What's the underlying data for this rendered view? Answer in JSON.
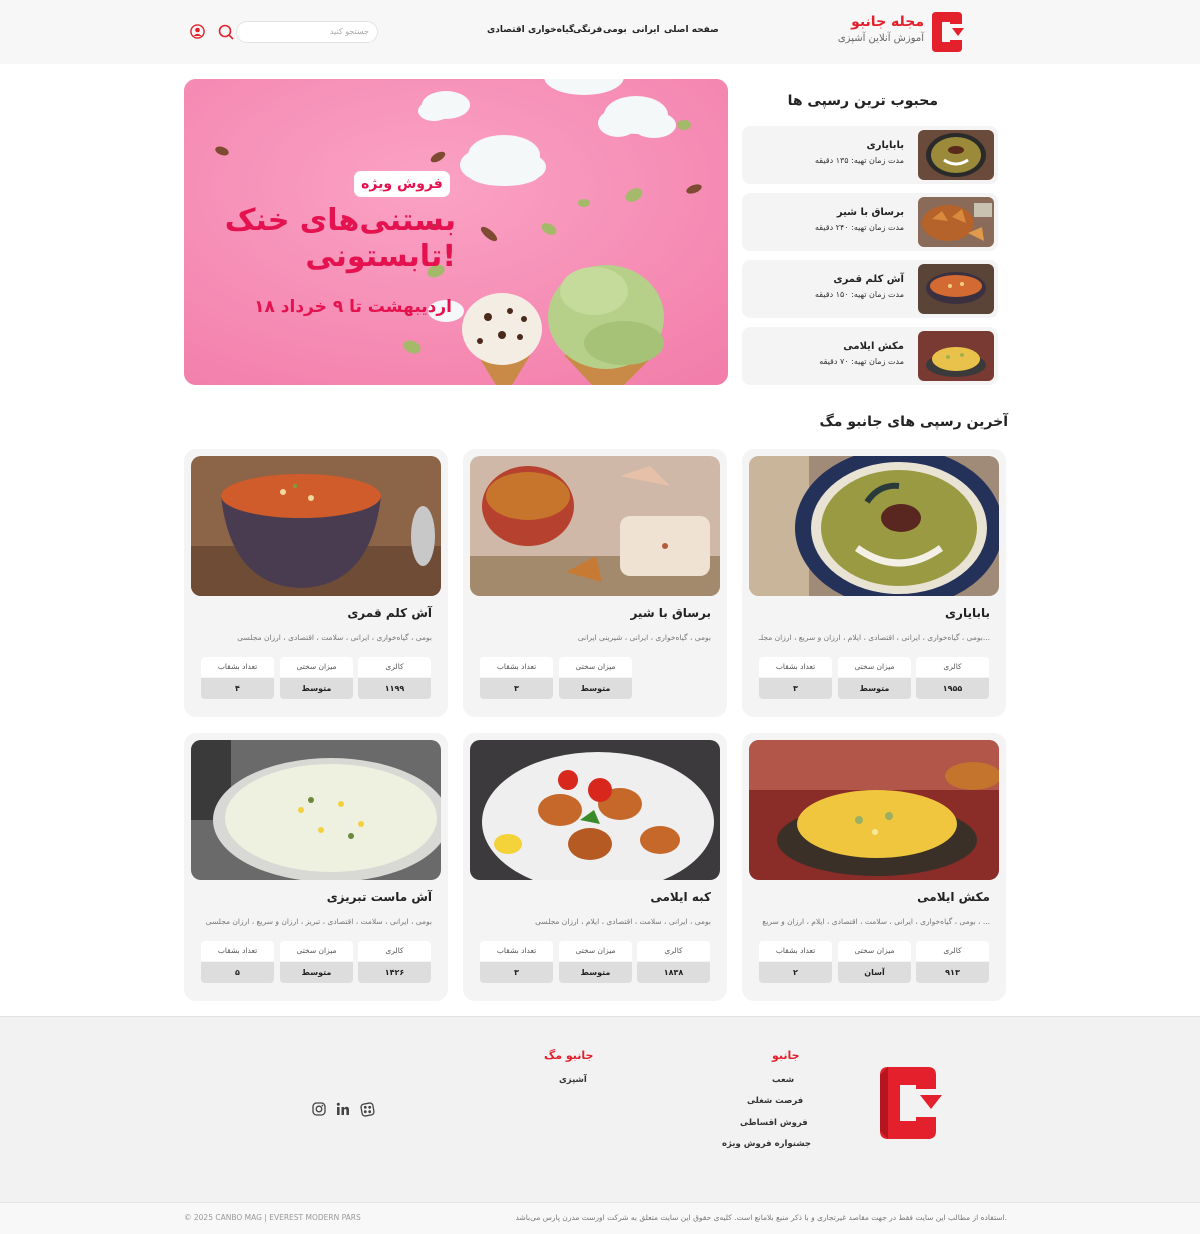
{
  "header": {
    "brand_title": "مجله جانبو",
    "brand_subtitle": "آموزش آنلاین آشپزی",
    "nav": [
      "صفحه اصلی",
      "ایرانی",
      "بومی",
      "فرنگی",
      "گیاه‌خواری",
      "اقتصادی"
    ],
    "search_placeholder": "جستجو کنید",
    "colors": {
      "brand": "#e3202b",
      "header_bg": "#f7f7f7"
    },
    "icons": [
      "logo-icon",
      "search-icon",
      "user-icon"
    ]
  },
  "banner": {
    "badge": "فروش ویژه",
    "line1": "بستنی‌های خنک",
    "line2": "تابستونی!",
    "dates": "۱۸ اردیبهشت تا ۹ خرداد",
    "colors": {
      "bg": "#f58ab2",
      "text": "#e4124f"
    }
  },
  "popular": {
    "title": "محبوب ترین رسپی ها",
    "time_label": "مدت زمان تهیه:",
    "items": [
      {
        "name": "بابایاری",
        "time": "۱۳۵ دقیقه"
      },
      {
        "name": "برساق با شیر",
        "time": "۲۴۰ دقیقه"
      },
      {
        "name": "آش کلم قمری",
        "time": "۱۵۰ دقیقه"
      },
      {
        "name": "مکش ایلامی",
        "time": "۷۰ دقیقه"
      }
    ]
  },
  "latest": {
    "title": "آخرین رسپی های جانبو مگ",
    "labels": {
      "calorie": "کالری",
      "difficulty": "میزان سختی",
      "servings": "تعداد بشقاب"
    },
    "cards": [
      {
        "title": "بابایاری",
        "tags": "بومی ، گیاه‌خواری ، ایرانی ، اقتصادی ، ایلام ، ارزان و سریع ، ارزان مجلـ...",
        "calorie": "۱۹۵۵",
        "difficulty": "متوسط",
        "servings": "۳"
      },
      {
        "title": "برساق با شیر",
        "tags": "بومی ، گیاه‌خواری ، ایرانی ، شیرینی ایرانی",
        "calorie": "",
        "difficulty": "متوسط",
        "servings": "۳"
      },
      {
        "title": "آش کلم قمری",
        "tags": "بومی ، گیاه‌خواری ، ایرانی ، سلامت ، اقتصادی ، ارزان مجلسی",
        "calorie": "۱۱۹۹",
        "difficulty": "متوسط",
        "servings": "۴"
      },
      {
        "title": "مکش ایلامی",
        "tags": "بومی ، گیاه‌خواری ، ایرانی ، سلامت ، اقتصادی ، ایلام ، ارزان و سریع ، ...",
        "calorie": "۹۱۳",
        "difficulty": "آسان",
        "servings": "۲"
      },
      {
        "title": "کبه ایلامی",
        "tags": "بومی ، ایرانی ، سلامت ، اقتصادی ، ایلام ، ارزان مجلسی",
        "calorie": "۱۸۳۸",
        "difficulty": "متوسط",
        "servings": "۳"
      },
      {
        "title": "آش ماست تبریزی",
        "tags": "بومی ، ایرانی ، سلامت ، اقتصادی ، تبریز ، ارزان و سریع ، ارزان مجلسی",
        "calorie": "۱۴۲۶",
        "difficulty": "متوسط",
        "servings": "۵"
      }
    ]
  },
  "footer": {
    "col1_title": "جانبو",
    "col1_links": [
      "شعب",
      "فرصت شغلی",
      "فروش اقساطی",
      "جشنواره فروش ویژه"
    ],
    "col2_title": "جانبو مگ",
    "col2_links": [
      "آشپزی"
    ],
    "social": [
      "instagram-icon",
      "linkedin-icon",
      "aparat-icon"
    ],
    "legal": "استفاده از مطالب این سایت فقط در جهت مقاصد غیرتجاری و با ذکر منبع بلامانع است. کلیه‌ی حقوق این سایت متعلق به شرکت اورست مدرن پارس می‌باشد.",
    "copyright": "© 2025 CANBO MAG | EVEREST MODERN PARS"
  }
}
